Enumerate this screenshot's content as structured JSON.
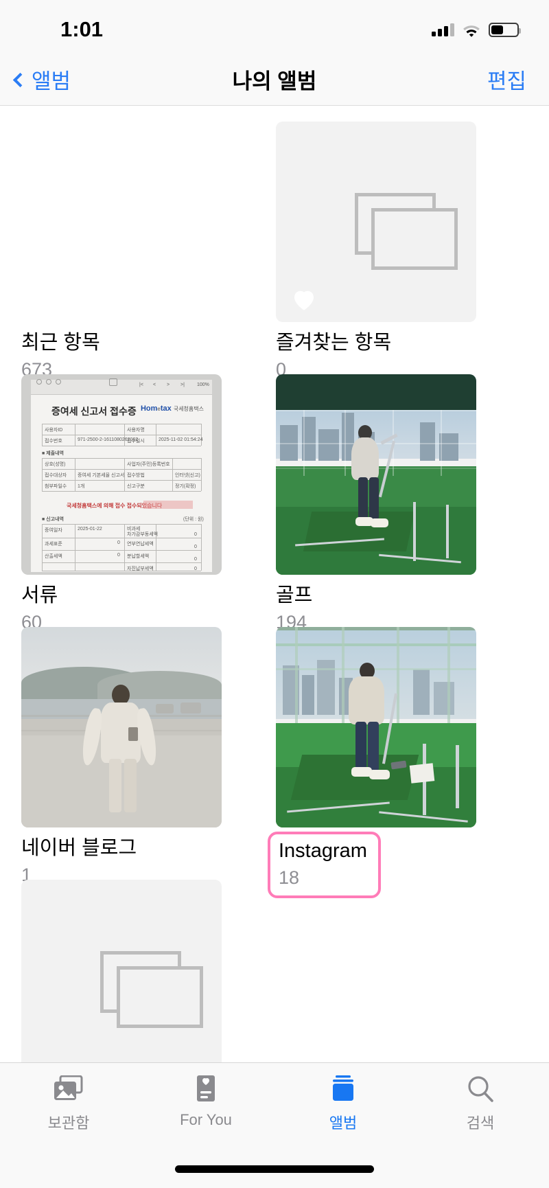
{
  "status_bar": {
    "time": "1:01",
    "signal_icon": "cellular-bars-icon",
    "signal_bars_filled": 3,
    "signal_bars_total": 4,
    "wifi_icon": "wifi-icon",
    "battery_icon": "battery-icon",
    "battery_level_percent": 45
  },
  "nav_bar": {
    "back_label": "앨범",
    "back_icon": "chevron-left-icon",
    "title": "나의 앨범",
    "edit_label": "편집"
  },
  "albums": [
    {
      "name": "최근 항목",
      "count": "673",
      "thumb_type": "empty",
      "highlighted": false
    },
    {
      "name": "즐겨찾는 항목",
      "count": "0",
      "thumb_type": "favorites",
      "highlighted": false
    },
    {
      "name": "서류",
      "count": "60",
      "thumb_type": "document",
      "highlighted": false
    },
    {
      "name": "골프",
      "count": "194",
      "thumb_type": "golf-wide",
      "highlighted": false
    },
    {
      "name": "네이버 블로그",
      "count": "1",
      "thumb_type": "blog",
      "highlighted": false
    },
    {
      "name": "Instagram",
      "count": "18",
      "thumb_type": "golf-swing",
      "highlighted": true
    }
  ],
  "document_thumb": {
    "title": "증여세 신고서 접수증",
    "logo": "Hom tax",
    "logo_sub": "국세청홈택스",
    "zoom_value": "100%",
    "notice": "국세청홈택스에 의해 접수 접수되었습니다",
    "rows": [
      {
        "label": "사용자ID",
        "value": ""
      },
      {
        "label": "접수번호",
        "value": "971-2500-2-1611080262002"
      },
      {
        "label": "상호(성명)",
        "value": ""
      },
      {
        "label": "접수대상자",
        "value": "증여세 기본세율 신고서"
      },
      {
        "label": "첨부파일수",
        "value": "1개"
      }
    ],
    "right_rows": [
      {
        "label": "사용자명",
        "value": ""
      },
      {
        "label": "사업자(주민)등록번호",
        "value": ""
      },
      {
        "label": "접수일시",
        "value": "2025-11-02 01:54:24"
      },
      {
        "label": "접수방법",
        "value": "인터넷(신고)"
      },
      {
        "label": "신고구분",
        "value": "정기(확정)"
      }
    ],
    "section1": "■ 제출내역",
    "section2": "■ 신고내역"
  },
  "tab_bar": {
    "items": [
      {
        "label": "보관함",
        "icon": "photos-library-icon",
        "active": false
      },
      {
        "label": "For You",
        "icon": "for-you-card-icon",
        "active": false
      },
      {
        "label": "앨범",
        "icon": "albums-stack-icon",
        "active": true
      },
      {
        "label": "검색",
        "icon": "search-magnifier-icon",
        "active": false
      }
    ],
    "home_indicator": "home-indicator"
  },
  "colors": {
    "accent_blue": "#1877f2",
    "link_blue": "#2b7df5",
    "highlight_pink": "#ff7cb8",
    "secondary_text": "#8e8e93",
    "chrome_bg": "#f9f9f9",
    "placeholder_bg": "#f2f2f2"
  }
}
